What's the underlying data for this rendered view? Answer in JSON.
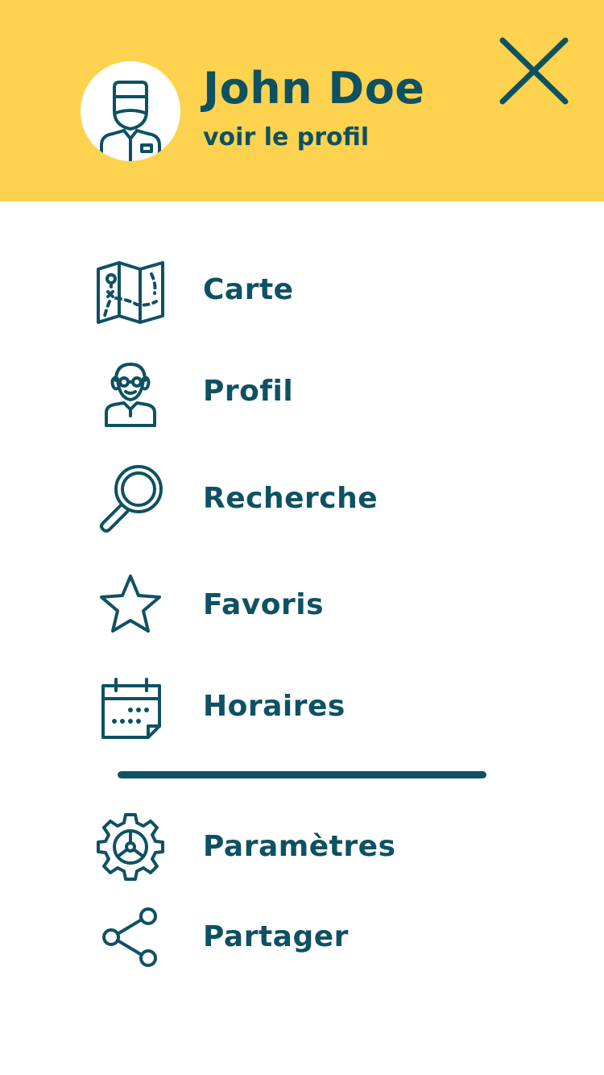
{
  "header": {
    "name": "John Doe",
    "profile_link": "voir le profil",
    "background_color": "#fdd24f",
    "avatar_icon": "doctor-avatar",
    "close_icon": "close-icon"
  },
  "theme": {
    "primary_color": "#0e5162",
    "background": "#ffffff"
  },
  "menu": {
    "items": [
      {
        "label": "Carte",
        "icon": "map-icon"
      },
      {
        "label": "Profil",
        "icon": "user-icon"
      },
      {
        "label": "Recherche",
        "icon": "search-icon"
      },
      {
        "label": "Favoris",
        "icon": "star-icon"
      },
      {
        "label": "Horaires",
        "icon": "calendar-icon"
      }
    ],
    "secondary_items": [
      {
        "label": "Paramètres",
        "icon": "gear-icon"
      },
      {
        "label": "Partager",
        "icon": "share-icon"
      }
    ]
  }
}
